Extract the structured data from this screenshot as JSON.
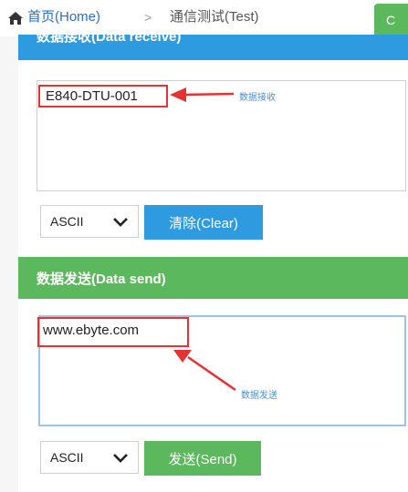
{
  "breadcrumb": {
    "home_label": "首页(Home)",
    "separator": ">",
    "current_label": "通信测试(Test)"
  },
  "corner_button": {
    "label": "C"
  },
  "receive": {
    "title": "数据接收(Data receive)",
    "value": "E840-DTU-001",
    "annotation": "数据接收",
    "encoding": "ASCII",
    "clear_label": "清除(Clear)"
  },
  "send": {
    "title": "数据发送(Data send)",
    "value": "www.ebyte.com",
    "annotation": "数据发送",
    "encoding": "ASCII",
    "send_label": "发送(Send)"
  },
  "colors": {
    "blue": "#2e9be0",
    "green": "#5cb85c",
    "highlight_red": "#e53333"
  }
}
